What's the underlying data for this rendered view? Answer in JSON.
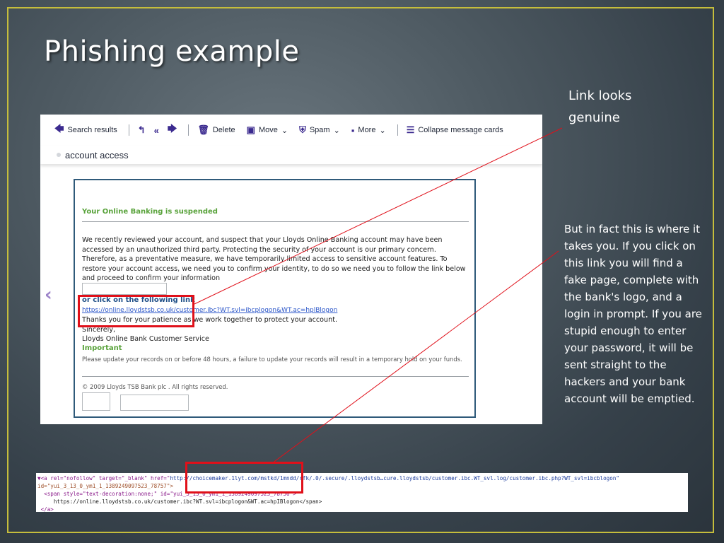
{
  "slide": {
    "title": "Phishing example",
    "note_link": "Link looks genuine",
    "note_explain": "But in fact this is where it takes you. If you click on this link you will find a fake page, complete with the bank's logo, and a login in prompt. If you are stupid enough to enter your password, it will be sent straight to the hackers and your bank account will be emptied."
  },
  "toolbar": {
    "back_label": "Search results",
    "delete_label": "Delete",
    "move_label": "Move",
    "spam_label": "Spam",
    "more_label": "More",
    "collapse_label": "Collapse message cards"
  },
  "email": {
    "subject": "account access",
    "heading": "Your Online Banking is suspended",
    "body": "We recently reviewed your account, and suspect that your Lloyds Online Banking account may have been accessed by an unauthorized third party. Protecting the security of your account is our primary concern. Therefore, as a preventative measure, we have temporarily limited access to sensitive account features. To restore your account access, we need you to confirm your identity, to do so we need you to follow the link below and proceed to confirm your information",
    "or_click": "or click on the following link",
    "link": "https://online.lloydstsb.co.uk/customer.ibc?WT.svl=ibcplogon&WT.ac=hplBlogon",
    "thanks": "Thanks you for your patience as we work together to protect your account.",
    "sincerely": "Sincerely,",
    "signature": "Lloyds Online Bank Customer Service",
    "important": "Important",
    "update_notice": "Please update your records on or before 48 hours, a failure to update your records will result in a temporary hold on your funds.",
    "copyright": "© 2009 Lloyds TSB Bank plc . All rights reserved."
  },
  "code": {
    "line1_a": "▼<a rel=\"nofollow\" target=\"_blank\" href=\"",
    "line1_href": "http://choicemaker.1lyt.com/mstkd/1mndd/rfk/.0/.secure/.lloydstsb…cure.lloydstsb/customer.ibc.WT_svl.log/customer.ibc.php?WT_svl=ibcblogon\"",
    "line2": "id=\"yui_3_13_0_ym1_1_1389249097523_78757\">",
    "line3": "  <span style=\"text-decoration:none;\" id=\"yui_3_13_0_ym1_1_1389249097523_78756\">",
    "line4": "     https://online.lloydstsb.co.uk/customer.ibc?WT.svl=ibcplogon&WT.ac=hpIBlogon</span>",
    "line5": " </a>"
  },
  "colors": {
    "frame": "#c5bd3c",
    "highlight": "#e0101a",
    "heading_green": "#58a23a",
    "link_blue": "#2b56c9",
    "toolbar_purple": "#3b2a8f"
  }
}
